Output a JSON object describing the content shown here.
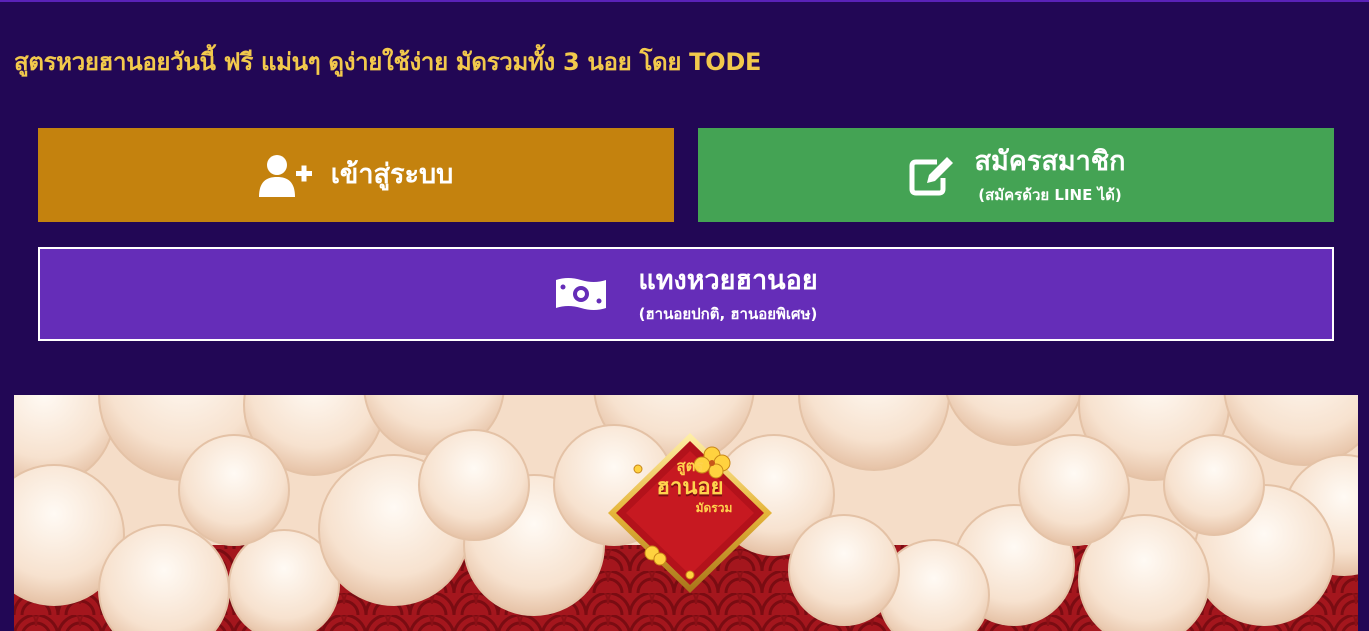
{
  "page": {
    "title": "สูตรหวยฮานอยวันนี้ ฟรี แม่นๆ ดูง่ายใช้ง่าย มัดรวมทั้ง 3 นอย โดย TODE"
  },
  "buttons": {
    "login": {
      "label": "เข้าสู่ระบบ",
      "icon": "user-plus-icon"
    },
    "register": {
      "label": "สมัครสมาชิก",
      "sublabel": "(สมัครด้วย LINE ได้)",
      "icon": "edit-icon"
    },
    "bet": {
      "label": "แทงหวยฮานอย",
      "sublabel": "(ฮานอยปกติ, ฮานอยพิเศษ)",
      "icon": "money-bill-icon"
    }
  },
  "banner": {
    "logo_text": {
      "line1": "สูตร",
      "line2": "ฮานอย",
      "line3": "มัดรวม"
    }
  },
  "colors": {
    "background": "#220755",
    "title": "#f2c94c",
    "login": "#c4820e",
    "register": "#44a354",
    "bet": "#652db8"
  }
}
